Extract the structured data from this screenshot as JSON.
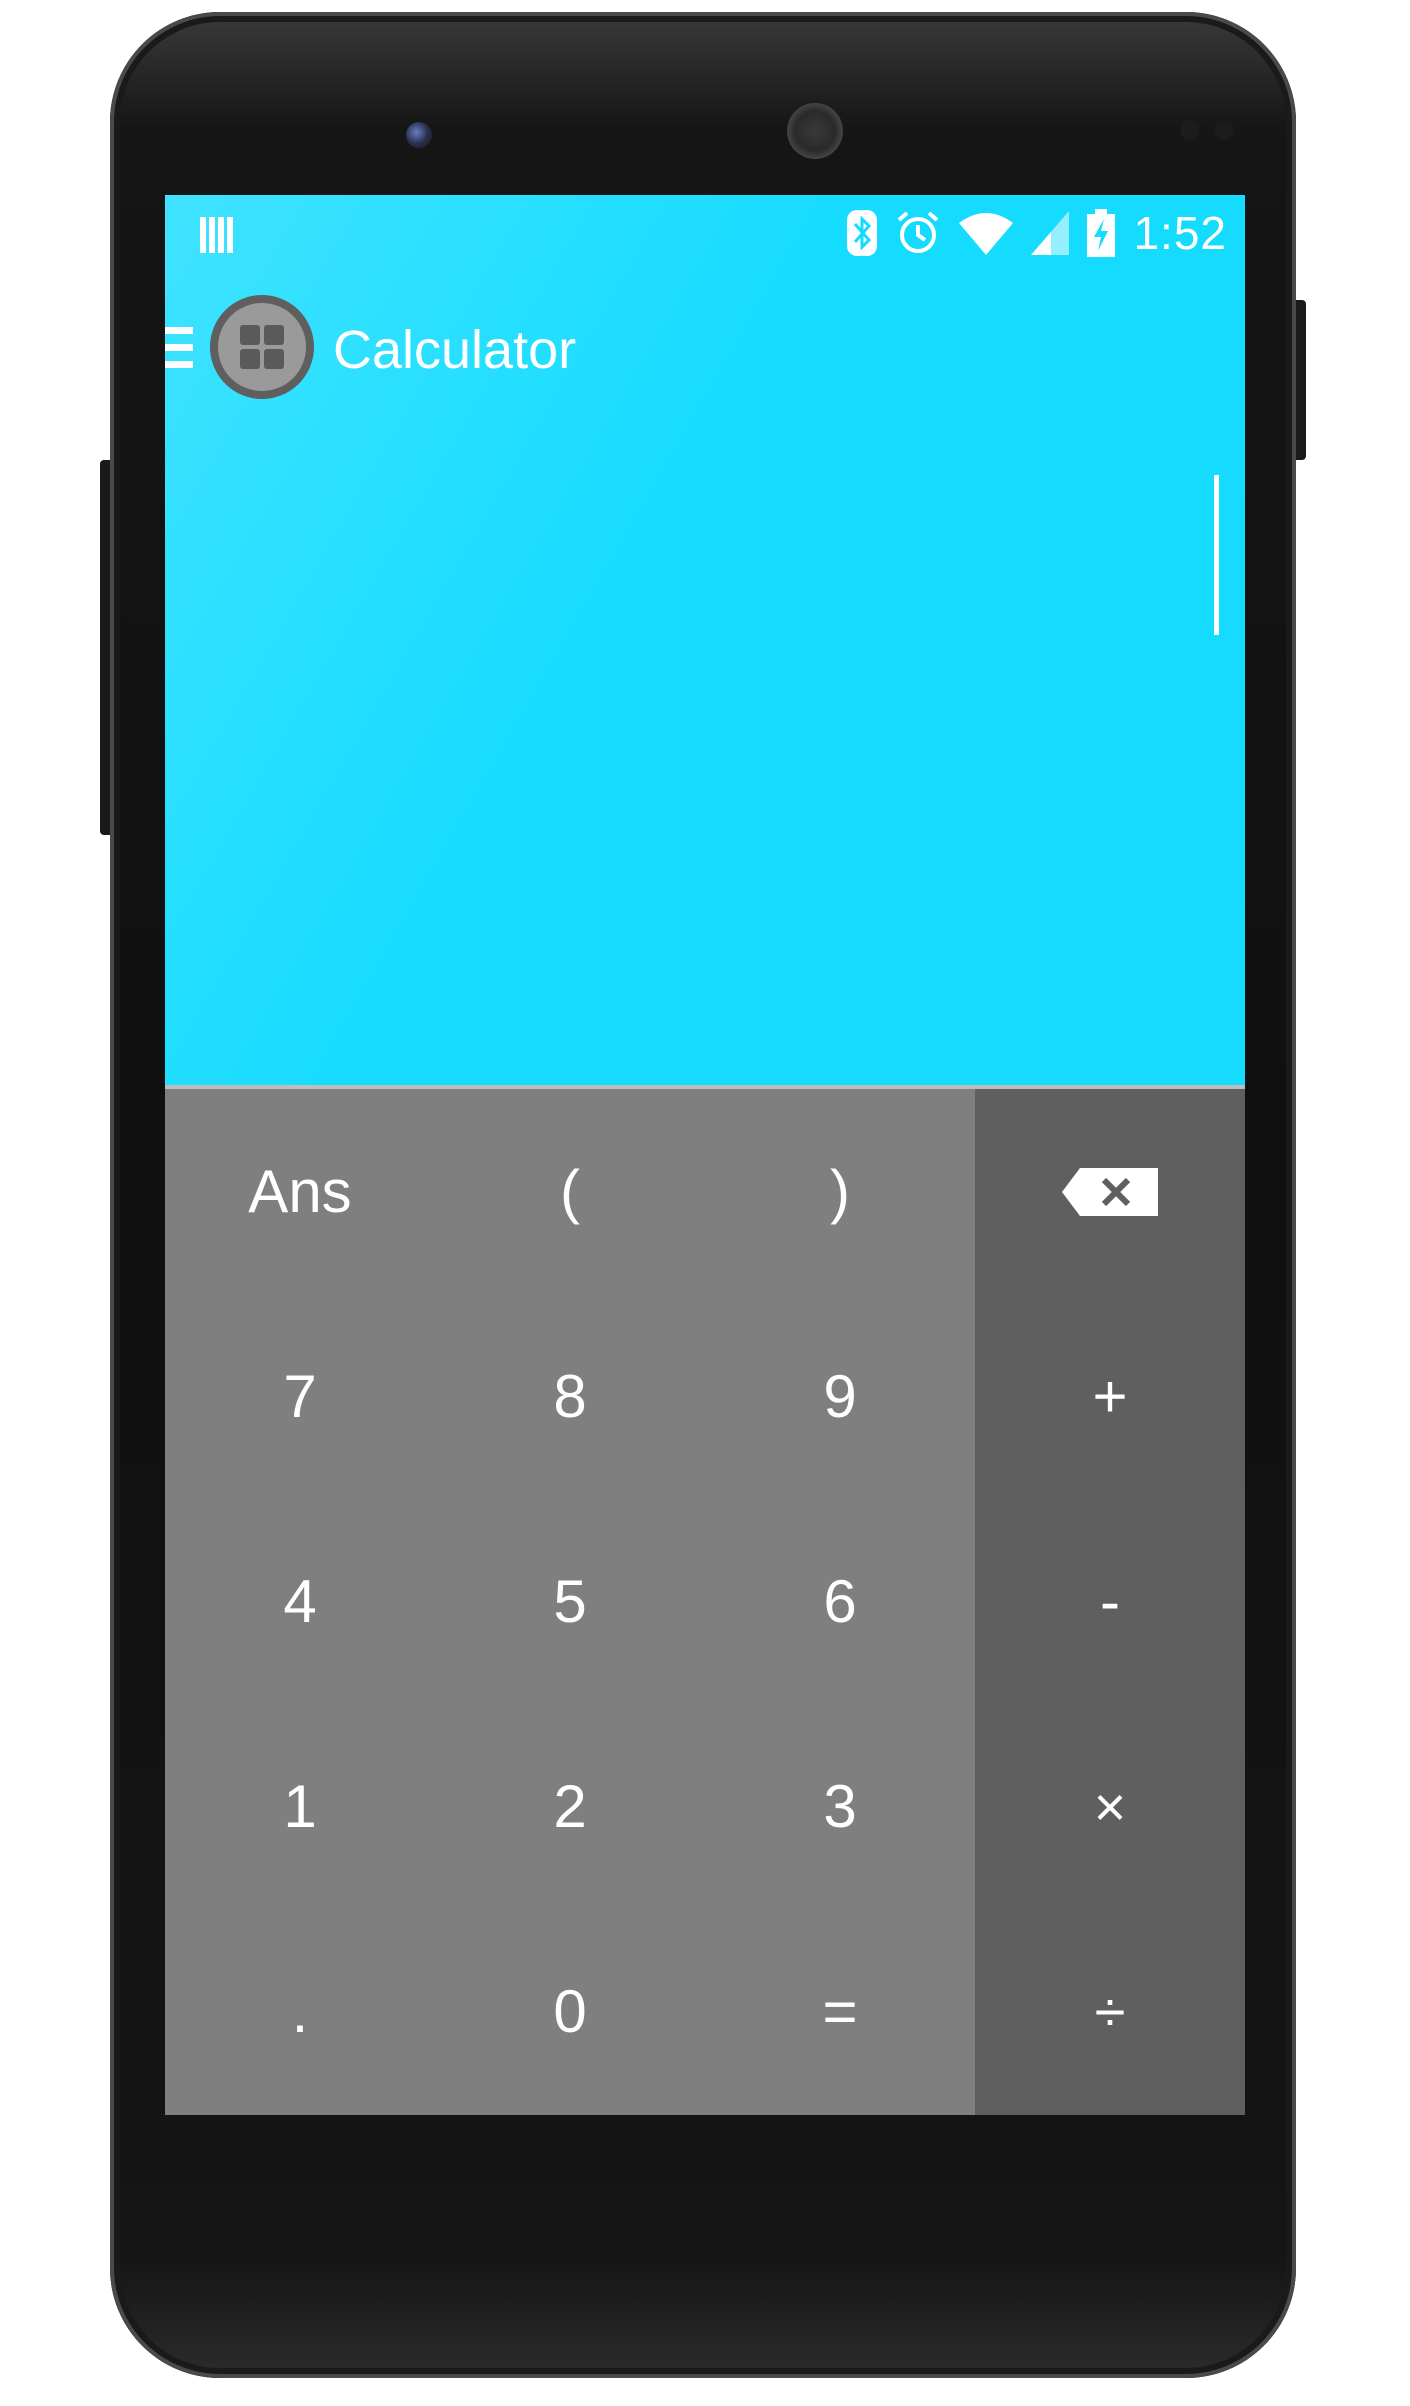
{
  "status_bar": {
    "time": "1:52",
    "icons": [
      "notification-bars-icon",
      "bluetooth-icon",
      "alarm-icon",
      "wifi-icon",
      "cell-signal-icon",
      "battery-charging-icon"
    ]
  },
  "app_bar": {
    "title": "Calculator",
    "menu_icon": "menu-icon",
    "app_icon": "calculator-app-icon"
  },
  "display": {
    "expression": ""
  },
  "keypad": {
    "rows": [
      [
        "Ans",
        "(",
        ")"
      ],
      [
        "7",
        "8",
        "9"
      ],
      [
        "4",
        "5",
        "6"
      ],
      [
        "1",
        "2",
        "3"
      ],
      [
        ".",
        "0",
        "="
      ]
    ]
  },
  "operators": {
    "backspace_icon": "backspace-icon",
    "keys": [
      "+",
      "-",
      "×",
      "÷"
    ]
  },
  "colors": {
    "display_background": "#15dcff",
    "keypad_background": "#7f7f7f",
    "operator_background": "#5f5f5f",
    "text": "#ffffff"
  }
}
